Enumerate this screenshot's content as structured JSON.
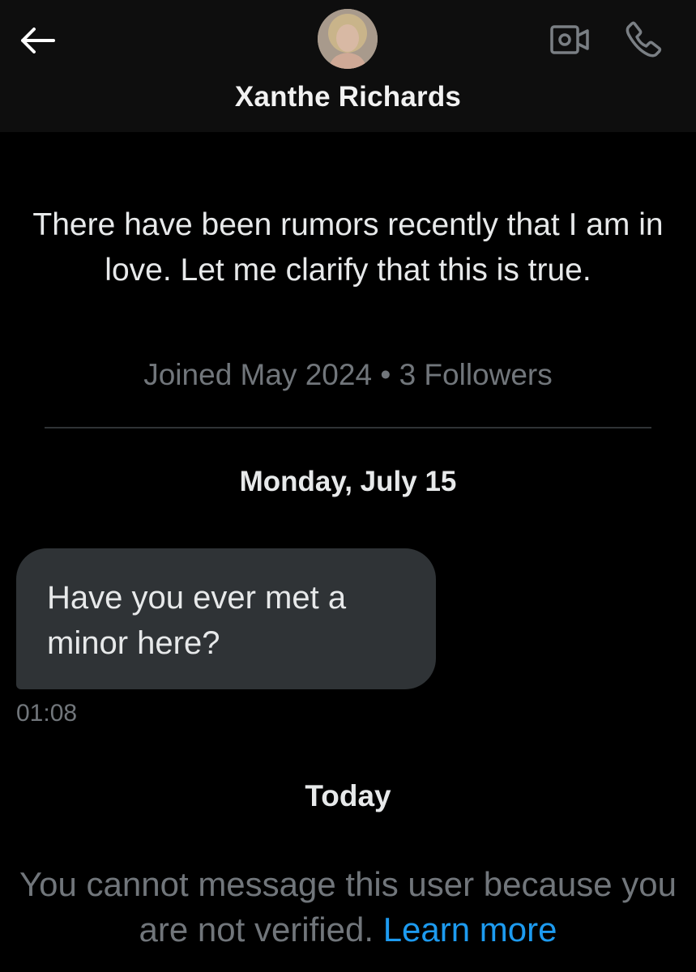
{
  "header": {
    "contact_name": "Xanthe Richards",
    "icons": {
      "back": "arrow-left-icon",
      "video": "video-camera-icon",
      "phone": "phone-icon"
    }
  },
  "profile": {
    "bio": "There have been rumors recently that I am in love. Let me clarify that this is true.",
    "joined": "Joined May 2024",
    "separator": "•",
    "followers": "3 Followers"
  },
  "conversation": {
    "date_separator": "Monday, July 15",
    "messages": [
      {
        "text": "Have you ever met a minor here?",
        "time": "01:08"
      }
    ],
    "today_label": "Today"
  },
  "notice": {
    "text": "You cannot message this user because you are not verified.",
    "link_label": "Learn more"
  },
  "colors": {
    "background": "#000000",
    "header_bg": "#0e0e0e",
    "bubble_bg": "#2f3336",
    "secondary_text": "#71767b",
    "link": "#1d9bf0"
  }
}
